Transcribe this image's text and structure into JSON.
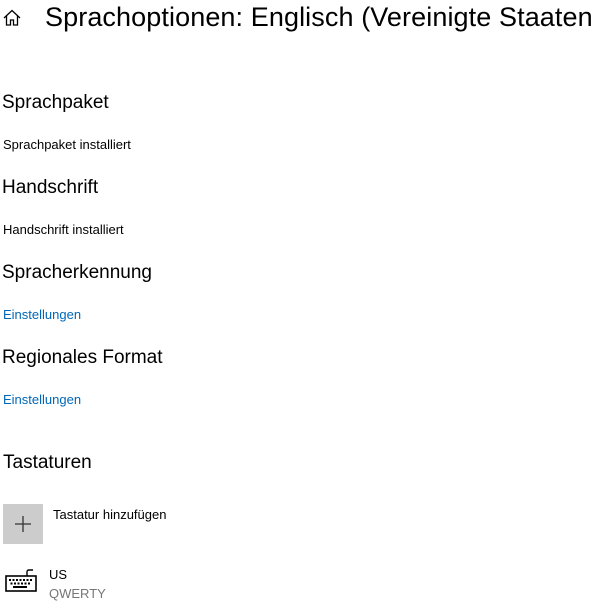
{
  "header": {
    "title": "Sprachoptionen: Englisch (Vereinigte Staaten)"
  },
  "sections": {
    "sprachpaket": {
      "heading": "Sprachpaket",
      "status": "Sprachpaket installiert"
    },
    "handschrift": {
      "heading": "Handschrift",
      "status": "Handschrift installiert"
    },
    "spracherkennung": {
      "heading": "Spracherkennung",
      "link": "Einstellungen"
    },
    "regionales_format": {
      "heading": "Regionales Format",
      "link": "Einstellungen"
    },
    "tastaturen": {
      "heading": "Tastaturen",
      "add_label": "Tastatur hinzufügen",
      "keyboards": [
        {
          "name": "US",
          "layout": "QWERTY"
        }
      ]
    }
  },
  "colors": {
    "link": "#0067b8",
    "tile_bg": "#cccccc",
    "secondary_text": "#767676"
  },
  "icons": {
    "home": "home-icon",
    "add": "plus-icon",
    "keyboard": "keyboard-icon"
  }
}
